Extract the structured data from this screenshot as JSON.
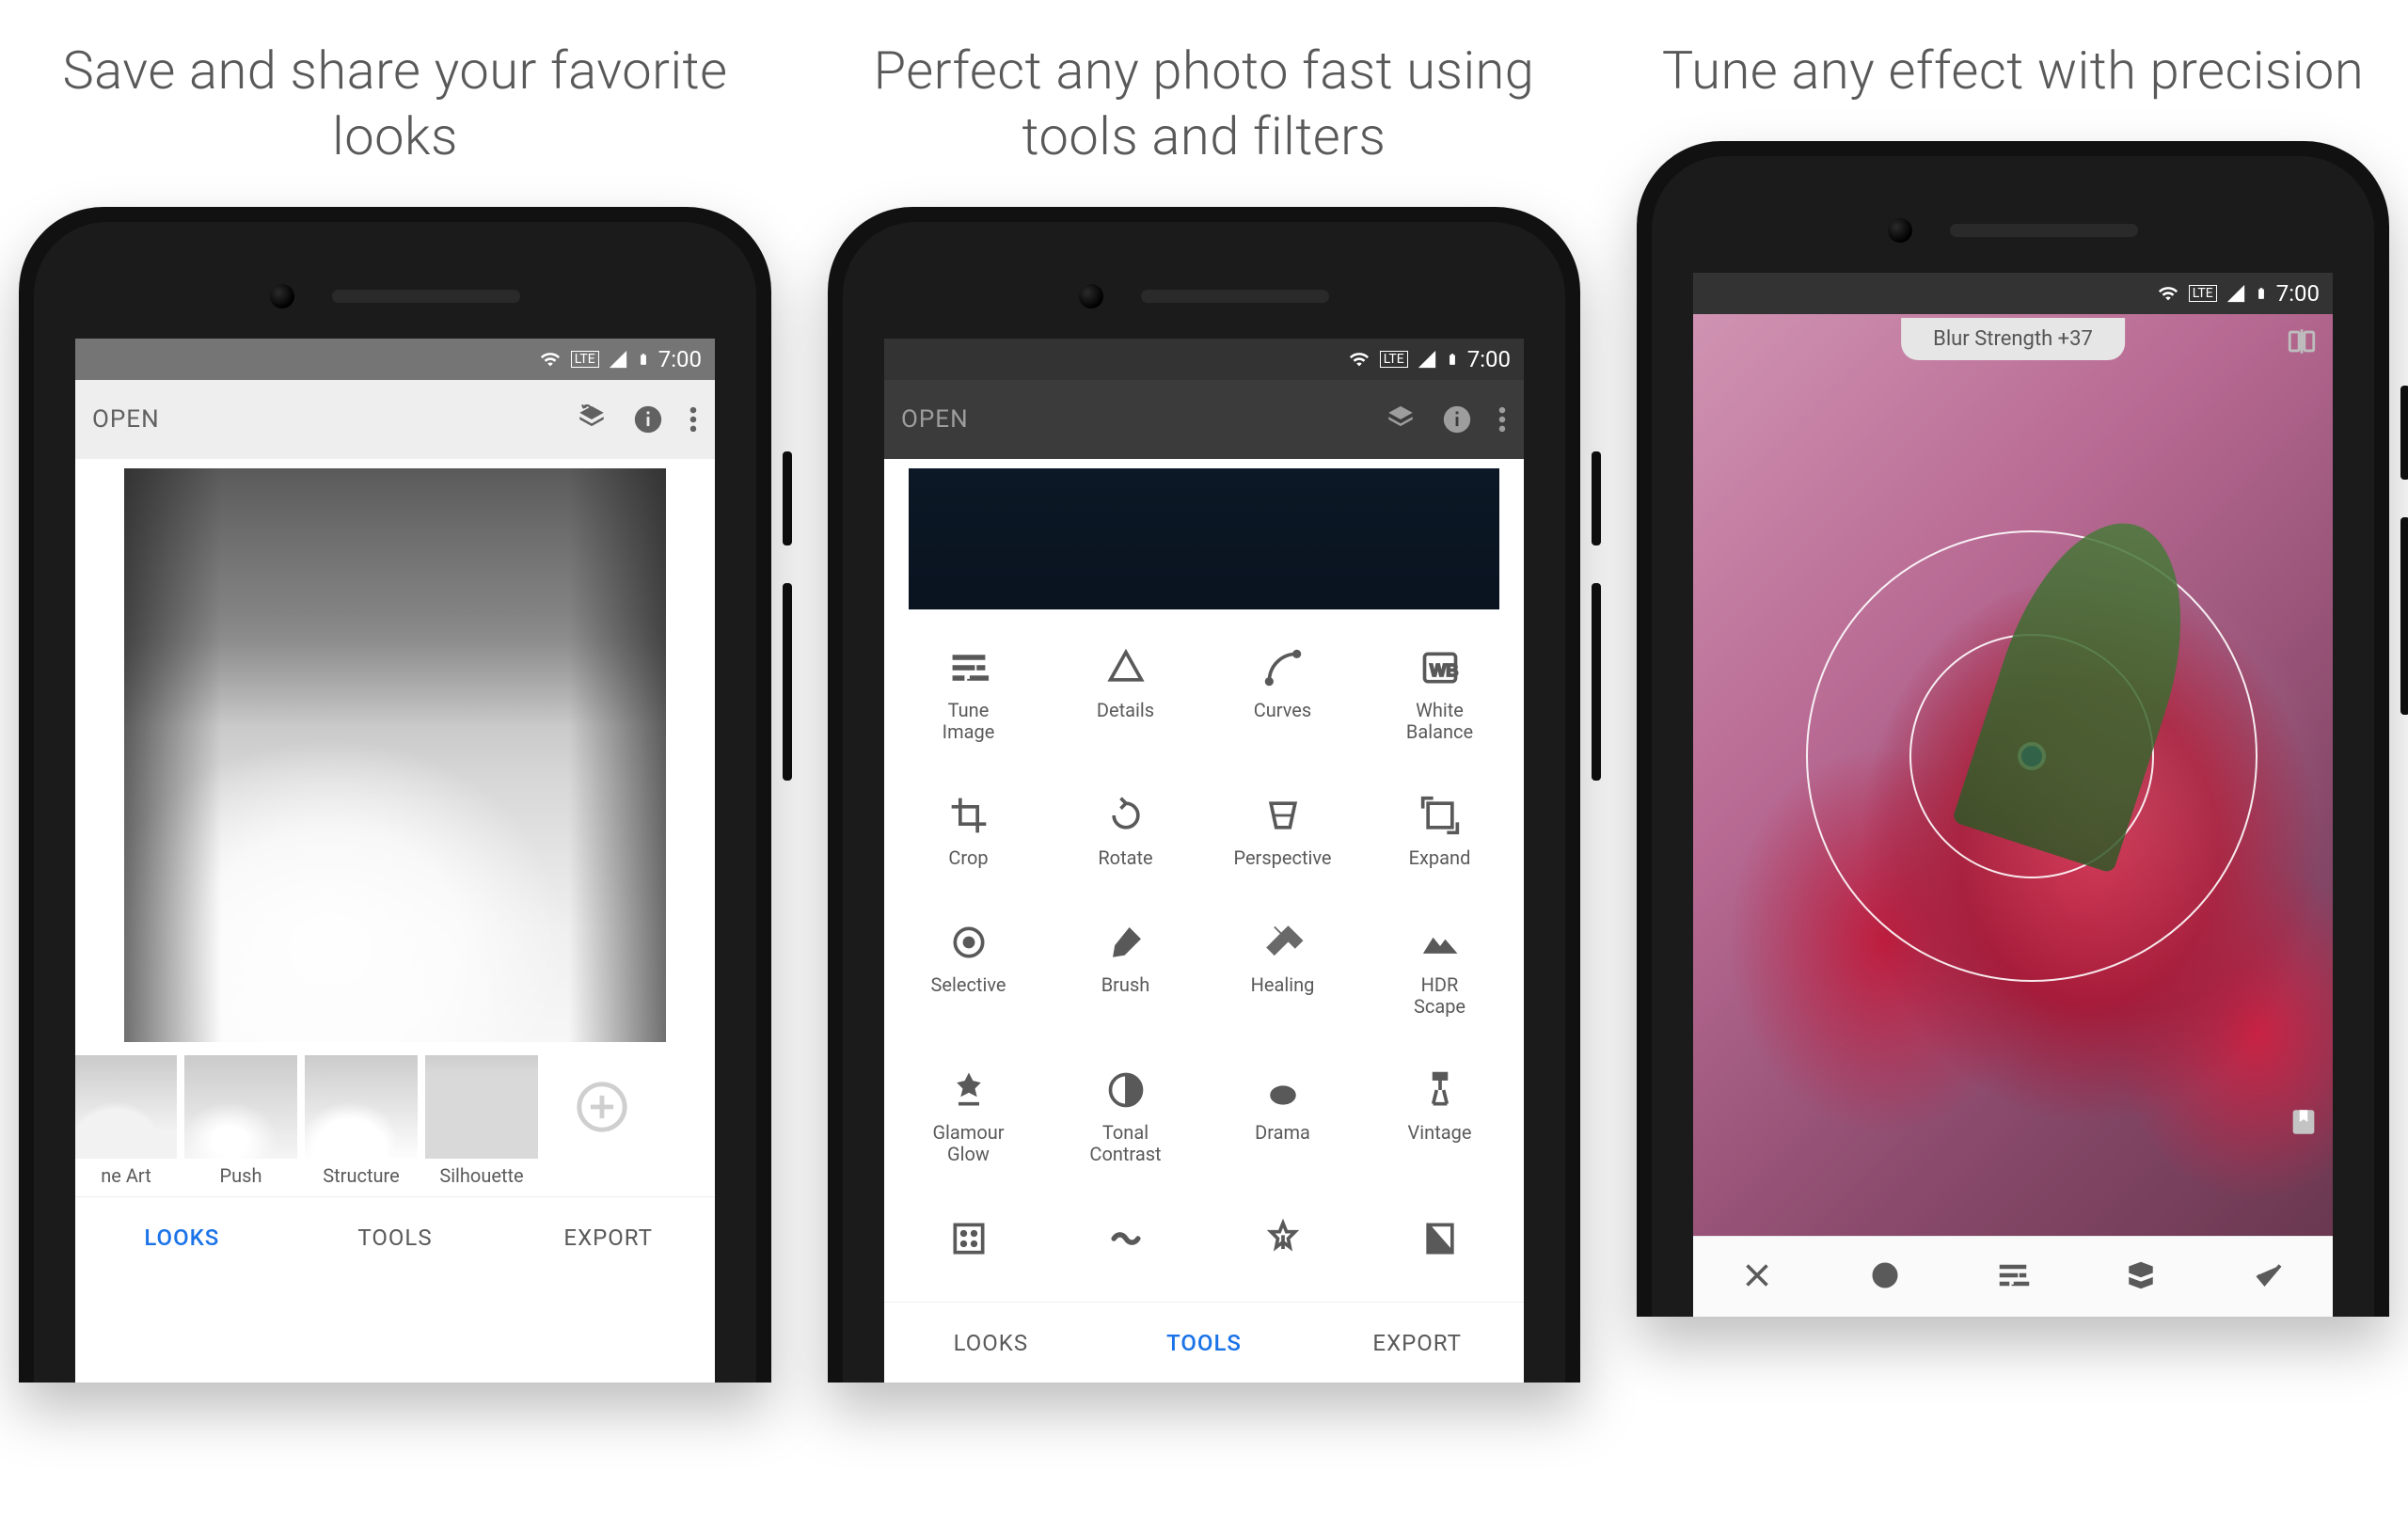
{
  "status_time": "7:00",
  "status_lte": "LTE",
  "panel1": {
    "heading": "Save and share your favorite looks",
    "open": "OPEN",
    "looks": [
      "ne Art",
      "Push",
      "Structure",
      "Silhouette"
    ],
    "tabs": {
      "looks": "LOOKS",
      "tools": "TOOLS",
      "export": "EXPORT"
    },
    "active_tab": "looks"
  },
  "panel2": {
    "heading": "Perfect any photo fast using tools and filters",
    "open": "OPEN",
    "tools": [
      {
        "label": "Tune Image",
        "icon": "tune"
      },
      {
        "label": "Details",
        "icon": "details"
      },
      {
        "label": "Curves",
        "icon": "curves"
      },
      {
        "label": "White Balance",
        "icon": "wb"
      },
      {
        "label": "Crop",
        "icon": "crop"
      },
      {
        "label": "Rotate",
        "icon": "rotate"
      },
      {
        "label": "Perspective",
        "icon": "perspective"
      },
      {
        "label": "Expand",
        "icon": "expand"
      },
      {
        "label": "Selective",
        "icon": "selective"
      },
      {
        "label": "Brush",
        "icon": "brush"
      },
      {
        "label": "Healing",
        "icon": "healing"
      },
      {
        "label": "HDR Scape",
        "icon": "hdr"
      },
      {
        "label": "Glamour Glow",
        "icon": "glow"
      },
      {
        "label": "Tonal Contrast",
        "icon": "tonal"
      },
      {
        "label": "Drama",
        "icon": "drama"
      },
      {
        "label": "Vintage",
        "icon": "vintage"
      },
      {
        "label": "",
        "icon": "grainy"
      },
      {
        "label": "",
        "icon": "retro"
      },
      {
        "label": "",
        "icon": "grunge"
      },
      {
        "label": "",
        "icon": "bw"
      }
    ],
    "tabs": {
      "looks": "LOOKS",
      "tools": "TOOLS",
      "export": "EXPORT"
    },
    "active_tab": "tools"
  },
  "panel3": {
    "heading": "Tune any effect with precision",
    "chip": "Blur Strength +37",
    "progress": 0.23,
    "toolbar": [
      "close",
      "selective",
      "tune",
      "styles",
      "apply"
    ]
  }
}
